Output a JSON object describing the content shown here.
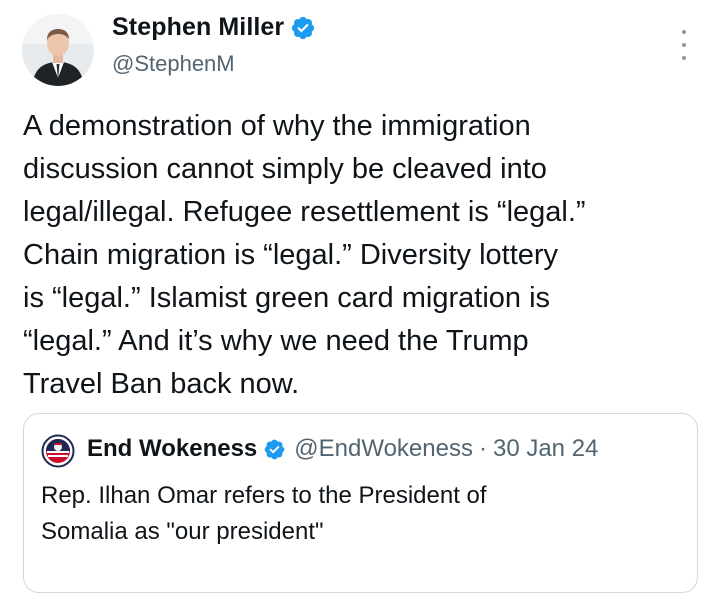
{
  "post": {
    "author": {
      "name": "Stephen Miller",
      "handle": "@StephenM",
      "verified_icon": "verified-badge-icon"
    },
    "more_icon": "more-vertical-icon",
    "text_lines": [
      "A demonstration of why the immigration",
      "discussion cannot simply be cleaved into",
      "legal/illegal. Refugee resettlement is “legal.”",
      "Chain migration is “legal.” Diversity lottery",
      "is “legal.” Islamist green card migration is",
      "“legal.” And it’s why we need the Trump",
      "Travel Ban back now."
    ],
    "quote": {
      "name": "End Wokeness",
      "handle": "@EndWokeness",
      "separator": "·",
      "date": "30 Jan 24",
      "text_lines": [
        "Rep. Ilhan Omar refers to the President of",
        "Somalia as \"our president\""
      ]
    }
  },
  "colors": {
    "text": "#0f1419",
    "secondary_text": "#536471",
    "verified_blue": "#1d9bf0",
    "border": "#cfd9de",
    "background": "#ffffff"
  }
}
